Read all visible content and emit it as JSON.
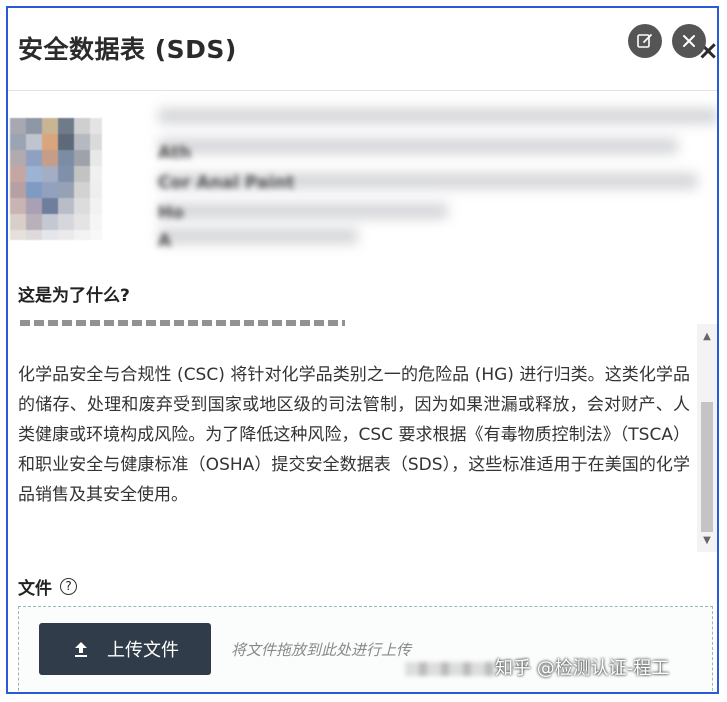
{
  "dialog": {
    "title": "安全数据表 (SDS)",
    "close_glyph": "×"
  },
  "overlay": {
    "edit_icon": "edit-icon",
    "close_icon": "close-icon"
  },
  "preview": {
    "blurred_line_1": "Ath",
    "blurred_line_2": "Cor Anal Paint",
    "blurred_line_3": "Ho",
    "blurred_line_4": "A"
  },
  "section": {
    "question": "这是为了什么?",
    "paragraph": "化学品安全与合规性 (CSC) 将针对化学品类别之一的危险品 (HG) 进行归类。这类化学品的储存、处理和废弃受到国家或地区级的司法管制，因为如果泄漏或释放，会对财产、人类健康或环境构成风险。为了降低这种风险，CSC 要求根据《有毒物质控制法》（TSCA）和职业安全与健康标准（OSHA）提交安全数据表（SDS），这些标准适用于在美国的化学品销售及其安全使用。"
  },
  "file": {
    "label": "文件",
    "help_glyph": "?",
    "upload_label": "上传文件",
    "drop_hint": "将文件拖放到此处进行上传"
  },
  "watermark": {
    "text": "知乎 @检测认证-程工"
  },
  "colors": {
    "frame_border": "#2a5bd7",
    "button_bg": "#303c49",
    "dropzone_border": "#9ab5bf"
  }
}
